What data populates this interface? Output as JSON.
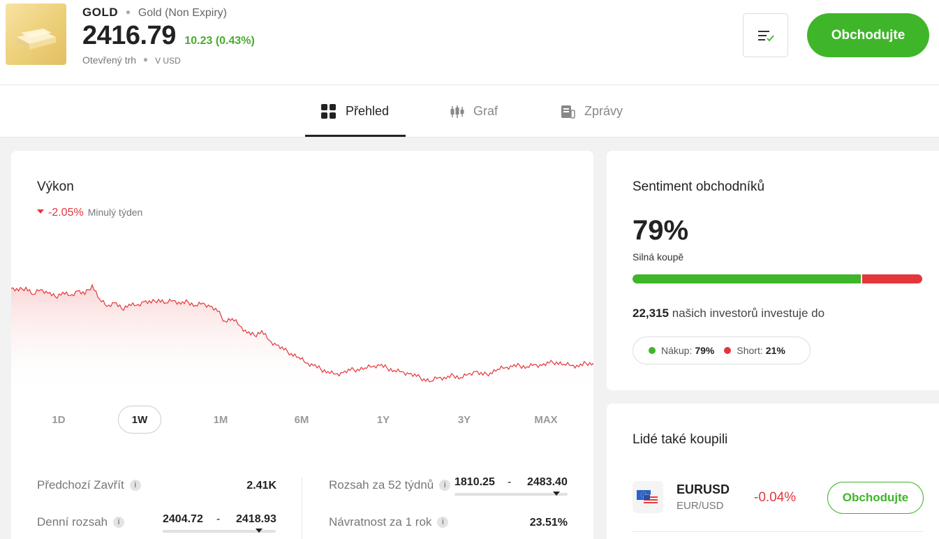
{
  "header": {
    "symbol": "GOLD",
    "name": "Gold (Non Expiry)",
    "price": "2416.79",
    "change": "10.23 (0.43%)",
    "market_status": "Otevřený trh",
    "currency": "V USD",
    "trade_button": "Obchodujte"
  },
  "tabs": [
    {
      "label": "Přehled",
      "icon": "grid-icon",
      "active": true
    },
    {
      "label": "Graf",
      "icon": "candlestick-icon",
      "active": false
    },
    {
      "label": "Zprávy",
      "icon": "news-icon",
      "active": false
    }
  ],
  "performance": {
    "title": "Výkon",
    "change": "-2.05%",
    "period": "Minulý týden",
    "ranges": [
      "1D",
      "1W",
      "1M",
      "6M",
      "1Y",
      "3Y",
      "MAX"
    ],
    "active_range": "1W",
    "stats": {
      "prev_close_label": "Předchozí Zavřít",
      "prev_close_value": "2.41K",
      "day_range_label": "Denní rozsah",
      "day_range_low": "2404.72",
      "day_range_high": "2418.93",
      "day_range_position": 0.85,
      "week52_label": "Rozsah za 52 týdnů",
      "week52_low": "1810.25",
      "week52_high": "2483.40",
      "week52_position": 0.9,
      "return_1y_label": "Návratnost za 1 rok",
      "return_1y_value": "23.51%",
      "info_glyph": "i",
      "dash": "-"
    }
  },
  "chart_data": {
    "type": "area",
    "title": "",
    "xlabel": "",
    "ylabel": "",
    "series": [
      {
        "values": [
          2467,
          2465,
          2468,
          2462,
          2466,
          2463,
          2460,
          2464,
          2461,
          2465,
          2462,
          2470,
          2458,
          2452,
          2455,
          2450,
          2454,
          2453,
          2456,
          2455,
          2458,
          2455,
          2457,
          2454,
          2456,
          2453,
          2455,
          2452,
          2448,
          2440,
          2442,
          2436,
          2430,
          2428,
          2432,
          2424,
          2420,
          2416,
          2413,
          2410,
          2405,
          2403,
          2400,
          2398,
          2396,
          2397,
          2399,
          2400,
          2401,
          2402,
          2403,
          2401,
          2399,
          2398,
          2396,
          2394,
          2392,
          2390,
          2393,
          2392,
          2395,
          2393,
          2396,
          2398,
          2395,
          2397,
          2400,
          2401,
          2402,
          2403,
          2402,
          2404,
          2403,
          2405,
          2406,
          2404,
          2403,
          2402,
          2405,
          2405
        ]
      }
    ],
    "color": "#e3363a",
    "fill": "#fdeaea",
    "grid": false
  },
  "sentiment": {
    "title": "Sentiment obchodníků",
    "percent": "79%",
    "label": "Silná koupě",
    "buy_fraction": 0.79,
    "investors_count": "22,315",
    "investors_text": "našich investorů investuje do",
    "buy_label": "Nákup:",
    "buy_value": "79%",
    "short_label": "Short:",
    "short_value": "21%",
    "buy_color": "#3fb52a",
    "sell_color": "#e3363a"
  },
  "also_bought": {
    "title": "Lidé také koupili",
    "items": [
      {
        "symbol": "EURUSD",
        "name": "EUR/USD",
        "change": "-0.04%",
        "button": "Obchodujte",
        "icon": "eu-us-flag-icon"
      }
    ]
  }
}
